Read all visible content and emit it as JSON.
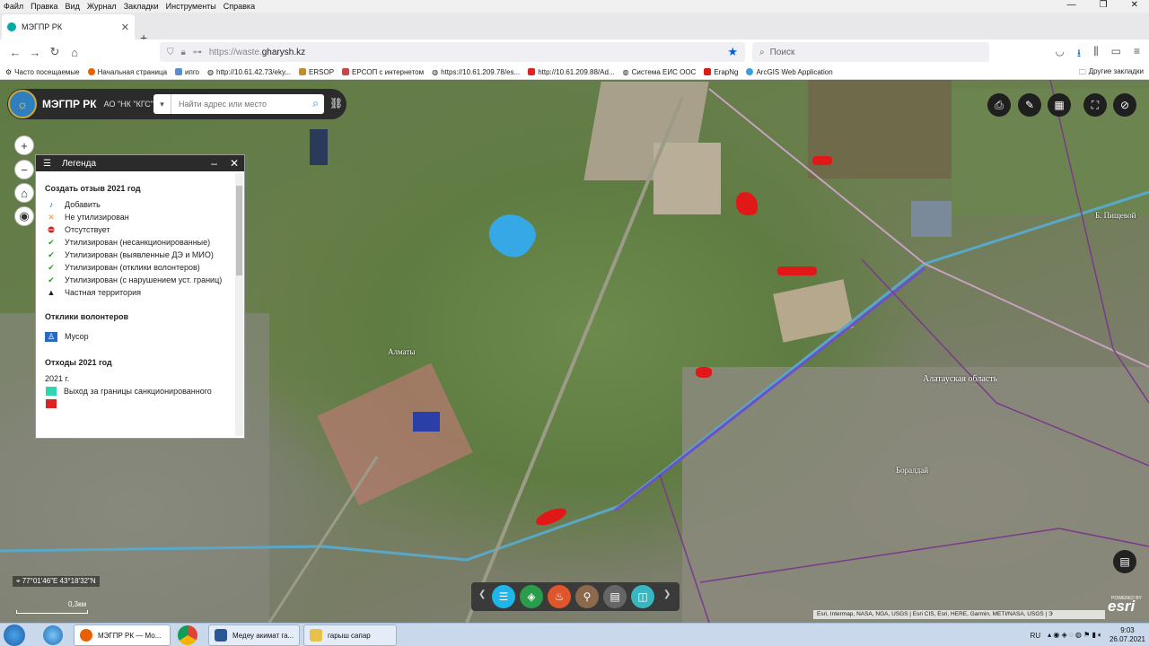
{
  "menu": [
    "Файл",
    "Правка",
    "Вид",
    "Журнал",
    "Закладки",
    "Инструменты",
    "Справка"
  ],
  "tab": {
    "title": "МЭГПР РК"
  },
  "url": {
    "prefix": "https://waste.",
    "domain": "gharysh.kz"
  },
  "search": {
    "placeholder": "Поиск"
  },
  "bookmarks": [
    "Часто посещаемые",
    "Начальная страница",
    "ипго",
    "http://10.61.42.73/eky...",
    "ERSOP",
    "ЕРСОП с интернетом",
    "https://10.61.209.78/es...",
    "http://10.61.209.88/Ad...",
    "Система ЕИС ООС",
    "ErapNg",
    "ArcGIS Web Application"
  ],
  "bookmarks_other": "Другие закладки",
  "app": {
    "title": "МЭГПР РК",
    "subtitle": "АО \"НК \"КГС\"",
    "search_placeholder": "Найти адрес или место"
  },
  "legend": {
    "title": "Легенда",
    "section1": "Создать отзыв 2021 год",
    "items1": [
      "Добавить",
      "Не утилизирован",
      "Отсутствует",
      "Утилизирован (несанкционированные)",
      "Утилизирован (выявленные ДЭ и МИО)",
      "Утилизирован (отклики волонтеров)",
      "Утилизирован (с нарушением уст. границ)",
      "Частная территория"
    ],
    "section2": "Отклики волонтеров",
    "items2": [
      "Мусор"
    ],
    "section3": "Отходы 2021 год",
    "year": "2021 г.",
    "items3": [
      "Выход за границы санкционированного"
    ],
    "colors": {
      "teal": "#2fd6b0",
      "red": "#d9241f"
    }
  },
  "coords": "77°01'46\"E 43°18'32\"N",
  "scale": "0,3км",
  "places": [
    "Алматы",
    "Алатауская область",
    "Боралдай",
    "Б. Пищевой"
  ],
  "attribution": "Esri, Intermap, NASA, NGA, USGS | Esri CIS, Esri, HERE, Garmin, METI/NASA, USGS | Э",
  "esri": "esri",
  "esri_powered": "POWERED BY",
  "taskbar": {
    "items": [
      "МЭГПР РК — Мо...",
      "Медеу акимат га...",
      "гарыш сапар"
    ],
    "lang": "RU",
    "time": "9:03",
    "date": "26.07.2021"
  }
}
